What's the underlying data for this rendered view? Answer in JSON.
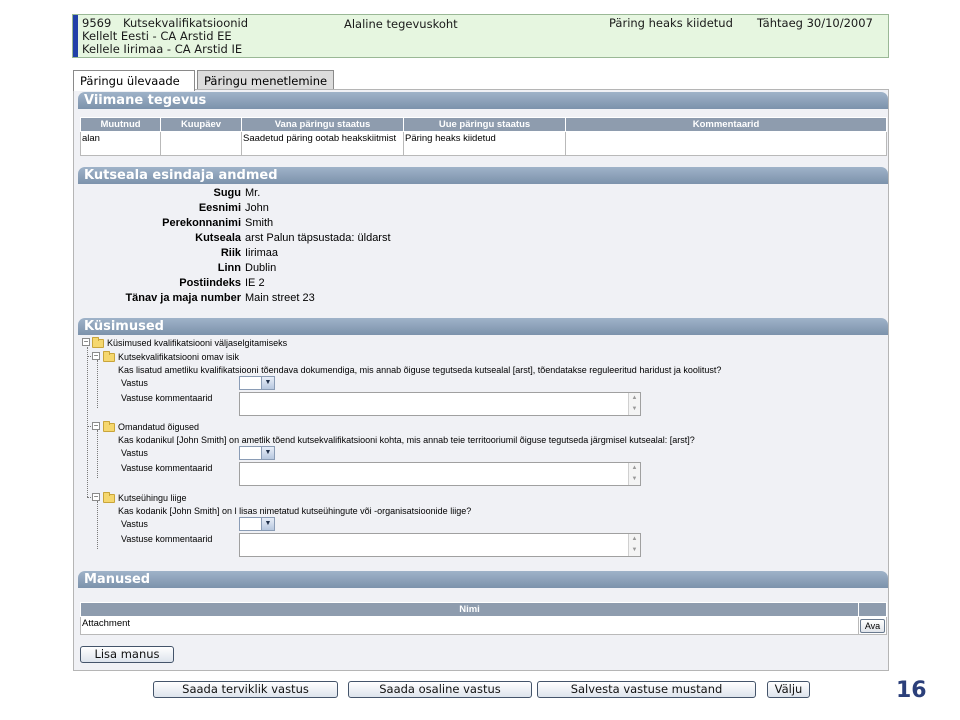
{
  "header": {
    "request_id": "9569",
    "title": "Kutsekvalifikatsioonid",
    "activity": "Alaline tegevuskoht",
    "status": "Päring heaks kiidetud",
    "deadline": "Tähtaeg 30/10/2007",
    "from": "Kellelt Eesti - CA Arstid EE",
    "to": "Kellele Iirimaa - CA Arstid IE"
  },
  "tabs": [
    {
      "label": "Päringu ülevaade",
      "active": true
    },
    {
      "label": "Päringu menetlemine",
      "active": false
    }
  ],
  "last_activity": {
    "title": "Viimane tegevus",
    "columns": [
      "Muutnud",
      "Kuupäev",
      "Vana päringu staatus",
      "Uue päringu staatus",
      "Kommentaarid"
    ],
    "rows": [
      [
        "alan",
        "",
        "Saadetud päring ootab heakskiitmist",
        "Päring heaks kiidetud",
        ""
      ]
    ]
  },
  "representative": {
    "title": "Kutseala esindaja andmed",
    "fields": [
      {
        "label": "Sugu",
        "value": "Mr."
      },
      {
        "label": "Eesnimi",
        "value": "John"
      },
      {
        "label": "Perekonnanimi",
        "value": "Smith"
      },
      {
        "label": "Kutseala",
        "value": "arst  Palun täpsustada:  üldarst"
      },
      {
        "label": "Riik",
        "value": "Iirimaa"
      },
      {
        "label": "Linn",
        "value": "Dublin"
      },
      {
        "label": "Postiindeks",
        "value": "IE 2"
      },
      {
        "label": "Tänav ja maja number",
        "value": "Main street 23"
      }
    ]
  },
  "questions": {
    "title": "Küsimused",
    "root": "Küsimused kvalifikatsiooni väljaselgitamiseks",
    "answer_label": "Vastus",
    "comment_label": "Vastuse kommentaarid",
    "groups": [
      {
        "name": "Kutsekvalifikatsiooni omav isik",
        "question": "Kas lisatud ametliku kvalifikatsiooni tõendava dokumendiga, mis annab õiguse tegutseda kutsealal [arst], tõendatakse reguleeritud haridust ja koolitust?"
      },
      {
        "name": "Omandatud õigused",
        "question": "Kas kodanikul [John Smith] on ametlik tõend kutsekvalifikatsiooni kohta, mis annab teie territooriumil õiguse tegutseda järgmisel kutsealal: [arst]?"
      },
      {
        "name": "Kutseühingu liige",
        "question": "Kas kodanik [John Smith] on l lisas nimetatud kutseühingute või -organisatsioonide liige?"
      }
    ]
  },
  "attachments": {
    "title": "Manused",
    "column": "Nimi",
    "rows": [
      {
        "name": "Attachment",
        "action": "Ava"
      }
    ],
    "add_label": "Lisa manus"
  },
  "footer_buttons": [
    "Saada terviklik vastus",
    "Saada osaline vastus",
    "Salvesta vastuse mustand",
    "Välju"
  ],
  "page_number": "16"
}
